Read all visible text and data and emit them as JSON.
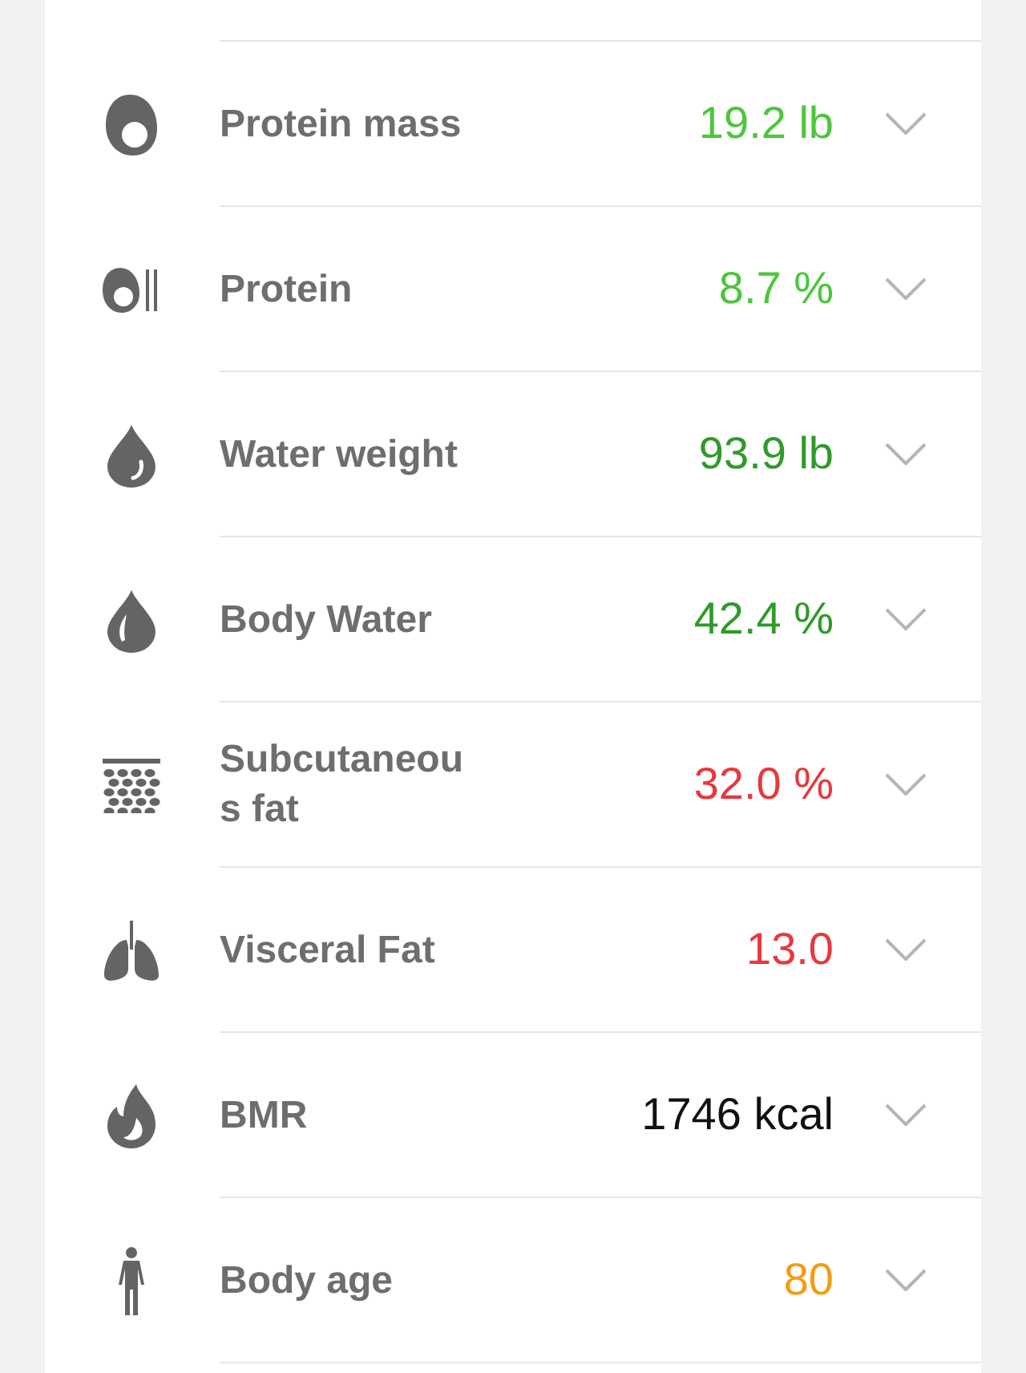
{
  "metrics": [
    {
      "kind": "protein-mass",
      "label": "Protein mass",
      "value": "19.2 lb",
      "color": "#4cc73c"
    },
    {
      "kind": "protein",
      "label": "Protein",
      "value": "8.7 %",
      "color": "#4cc73c"
    },
    {
      "kind": "water-weight",
      "label": "Water weight",
      "value": "93.9 lb",
      "color": "#2f9a2a"
    },
    {
      "kind": "body-water",
      "label": "Body Water",
      "value": "42.4 %",
      "color": "#2f9a2a"
    },
    {
      "kind": "subcutaneous",
      "label": "Subcutaneou\ns fat",
      "value": "32.0 %",
      "color": "#e8383d"
    },
    {
      "kind": "visceral",
      "label": "Visceral Fat",
      "value": "13.0",
      "color": "#e8383d"
    },
    {
      "kind": "bmr",
      "label": "BMR",
      "value": "1746 kcal",
      "color": "#111111"
    },
    {
      "kind": "body-age",
      "label": "Body age",
      "value": "80",
      "color": "#f39c12"
    }
  ]
}
